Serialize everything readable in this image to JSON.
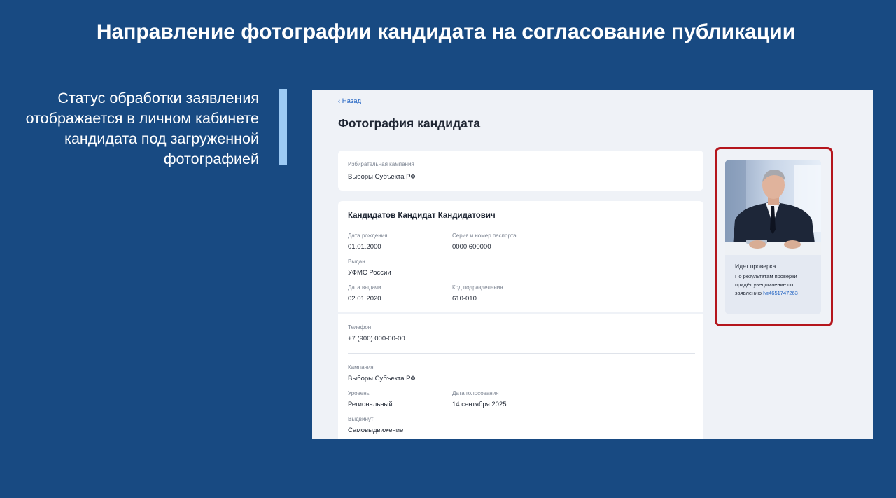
{
  "slide": {
    "title": "Направление фотографии кандидата на согласование публикации",
    "side_text": "Статус обработки заявления отображается в личном кабинете кандидата под загруженной фотографией"
  },
  "page": {
    "back_label": "‹ Назад",
    "title": "Фотография кандидата"
  },
  "campaign_card": {
    "label": "Избирательная кампания",
    "value": "Выборы Субъекта РФ"
  },
  "candidate": {
    "name": "Кандидатов Кандидат Кандидатович",
    "fields": {
      "birth_date_label": "Дата рождения",
      "birth_date": "01.01.2000",
      "passport_label": "Серия и номер паспорта",
      "passport": "0000 600000",
      "issued_by_label": "Выдан",
      "issued_by": "УФМС России",
      "issue_date_label": "Дата выдачи",
      "issue_date": "02.01.2020",
      "division_code_label": "Код подразделения",
      "division_code": "610-010",
      "phone_label": "Телефон",
      "phone": "+7 (900) 000-00-00",
      "campaign_label": "Кампания",
      "campaign": "Выборы Субъекта РФ",
      "level_label": "Уровень",
      "level": "Региональный",
      "vote_date_label": "Дата голосования",
      "vote_date": "14 сентября 2025",
      "nominated_label": "Выдвинут",
      "nominated": "Самовыдвижение"
    }
  },
  "photo_status": {
    "title": "Идет проверка",
    "text": "По результатам проверки придёт уведомление по заявлению ",
    "link": "№4651747263"
  },
  "colors": {
    "background": "#184a82",
    "accent_bar": "#9ccaf4",
    "highlight_border": "#b5161d",
    "link": "#1b5fc1"
  }
}
